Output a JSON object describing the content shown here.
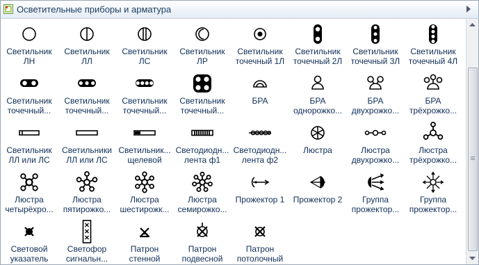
{
  "window": {
    "title": "Осветительные приборы и арматура"
  },
  "items": [
    {
      "icon": "lamp-ln-icon",
      "l1": "Светильник",
      "l2": "ЛН"
    },
    {
      "icon": "lamp-ll-icon",
      "l1": "Светильник",
      "l2": "ЛЛ"
    },
    {
      "icon": "lamp-ls-icon",
      "l1": "Светильник",
      "l2": "ЛС"
    },
    {
      "icon": "lamp-lr-icon",
      "l1": "Светильник",
      "l2": "ЛР"
    },
    {
      "icon": "point-lamp-1-icon",
      "l1": "Светильник",
      "l2": "точечный 1Л"
    },
    {
      "icon": "point-lamp-2-icon",
      "l1": "Светильник",
      "l2": "точечный 2Л"
    },
    {
      "icon": "point-lamp-3-icon",
      "l1": "Светильник",
      "l2": "точечный 3Л"
    },
    {
      "icon": "point-lamp-4-icon",
      "l1": "Светильник",
      "l2": "точечный 4Л"
    },
    {
      "icon": "point-lamp-h2-icon",
      "l1": "Светильник",
      "l2": "точечный..."
    },
    {
      "icon": "point-lamp-h3-icon",
      "l1": "Светильник",
      "l2": "точечный..."
    },
    {
      "icon": "point-lamp-h4-icon",
      "l1": "Светильник",
      "l2": "точечный..."
    },
    {
      "icon": "point-lamp-quad-icon",
      "l1": "Светильник",
      "l2": "точечный..."
    },
    {
      "icon": "wall-lamp-icon",
      "l1": "БРА",
      "l2": ""
    },
    {
      "icon": "wall-lamp-1-icon",
      "l1": "БРА",
      "l2": "однорожко..."
    },
    {
      "icon": "wall-lamp-2-icon",
      "l1": "БРА",
      "l2": "двухрожко..."
    },
    {
      "icon": "wall-lamp-3-icon",
      "l1": "БРА",
      "l2": "трёхрожко..."
    },
    {
      "icon": "fluorescent-icon",
      "l1": "Светильник",
      "l2": "ЛЛ или ЛС"
    },
    {
      "icon": "fluorescent-2-icon",
      "l1": "Светильники",
      "l2": "ЛЛ или ЛС"
    },
    {
      "icon": "slot-lamp-icon",
      "l1": "Светильник...",
      "l2": "щелевой"
    },
    {
      "icon": "led-strip-1-icon",
      "l1": "Светодиодн...",
      "l2": "лента ф1"
    },
    {
      "icon": "led-strip-2-icon",
      "l1": "Светодиодн...",
      "l2": "лента ф2"
    },
    {
      "icon": "chandelier-icon",
      "l1": "Люстра",
      "l2": ""
    },
    {
      "icon": "chandelier-2-icon",
      "l1": "Люстра",
      "l2": "двухрожко..."
    },
    {
      "icon": "chandelier-3-icon",
      "l1": "Люстра",
      "l2": "трёхрожко..."
    },
    {
      "icon": "chandelier-4-icon",
      "l1": "Люстра",
      "l2": "четырёхро..."
    },
    {
      "icon": "chandelier-5-icon",
      "l1": "Люстра",
      "l2": "пятирожко..."
    },
    {
      "icon": "chandelier-6-icon",
      "l1": "Люстра",
      "l2": "шестирожк..."
    },
    {
      "icon": "chandelier-7-icon",
      "l1": "Люстра",
      "l2": "семирожко..."
    },
    {
      "icon": "projector-1-icon",
      "l1": "Прожектор 1",
      "l2": ""
    },
    {
      "icon": "projector-2-icon",
      "l1": "Прожектор 2",
      "l2": ""
    },
    {
      "icon": "projector-group-1-icon",
      "l1": "Группа",
      "l2": "прожектор..."
    },
    {
      "icon": "projector-group-2-icon",
      "l1": "Группа",
      "l2": "прожектор..."
    },
    {
      "icon": "light-indicator-icon",
      "l1": "Световой",
      "l2": "указатель"
    },
    {
      "icon": "signal-light-icon",
      "l1": "Светофор",
      "l2": "сигнальн..."
    },
    {
      "icon": "socket-wall-icon",
      "l1": "Патрон",
      "l2": "стенной"
    },
    {
      "icon": "socket-hanging-icon",
      "l1": "Патрон",
      "l2": "подвесной"
    },
    {
      "icon": "socket-ceiling-icon",
      "l1": "Патрон",
      "l2": "потолочный"
    }
  ]
}
